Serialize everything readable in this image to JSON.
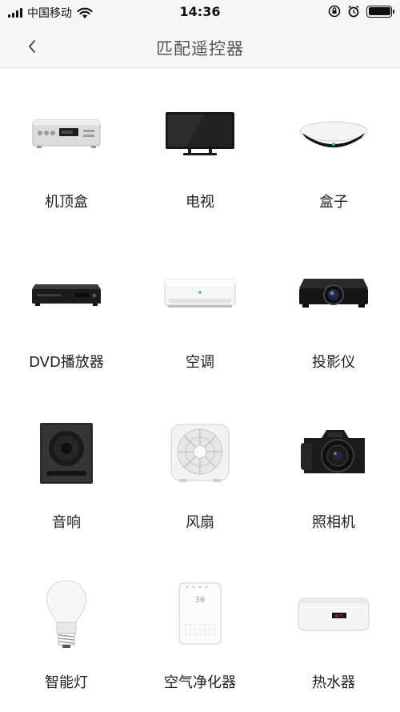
{
  "status_bar": {
    "carrier": "中国移动",
    "time": "14:36"
  },
  "nav": {
    "title": "匹配遥控器"
  },
  "devices": [
    {
      "label": "机顶盒",
      "icon": "set-top-box-icon"
    },
    {
      "label": "电视",
      "icon": "tv-icon"
    },
    {
      "label": "盒子",
      "icon": "media-box-icon"
    },
    {
      "label": "DVD播放器",
      "icon": "dvd-player-icon"
    },
    {
      "label": "空调",
      "icon": "air-conditioner-icon"
    },
    {
      "label": "投影仪",
      "icon": "projector-icon"
    },
    {
      "label": "音响",
      "icon": "speaker-icon"
    },
    {
      "label": "风扇",
      "icon": "fan-icon"
    },
    {
      "label": "照相机",
      "icon": "camera-icon"
    },
    {
      "label": "智能灯",
      "icon": "smart-bulb-icon"
    },
    {
      "label": "空气净化器",
      "icon": "air-purifier-icon"
    },
    {
      "label": "热水器",
      "icon": "water-heater-icon"
    }
  ],
  "screen_text": {
    "purifier_display": "36",
    "heater_display": "45℃"
  }
}
